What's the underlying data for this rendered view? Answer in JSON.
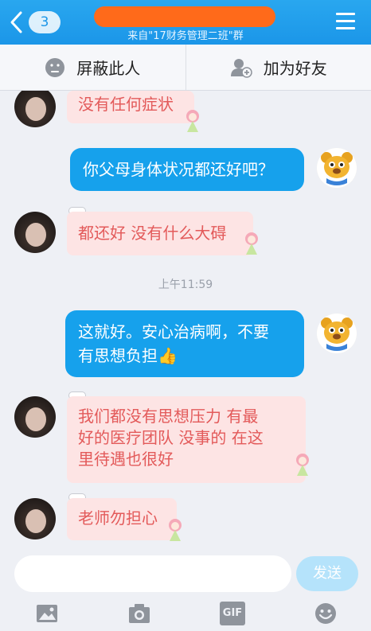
{
  "header": {
    "back_count": "3",
    "subtitle": "来自\"17财务管理二班\"群"
  },
  "actions": {
    "block": "屏蔽此人",
    "add_friend": "加为好友"
  },
  "messages": [
    {
      "side": "left",
      "text": "没有任何症状"
    },
    {
      "side": "right",
      "text": "你父母身体状况都还好吧？"
    },
    {
      "side": "left",
      "text": "都还好 没有什么大碍"
    },
    {
      "side": "right",
      "line1": "这就好。安心治病啊，不要",
      "line2": "有思想负担"
    },
    {
      "side": "left",
      "line1": "我们都没有思想压力 有最",
      "line2": "好的医疗团队 没事的 在这",
      "line3": "里待遇也很好"
    },
    {
      "side": "left",
      "text": "老师勿担心"
    }
  ],
  "timestamp": "上午11:59",
  "emoji": "👍",
  "input": {
    "value": "",
    "send_label": "发送"
  },
  "toolbar": {
    "gif_label": "GIF"
  },
  "colors": {
    "header": "#1b96e8",
    "title_redaction": "#ff6a1a",
    "left_bubble": "#fde4e4",
    "left_text": "#e35a5a",
    "right_bubble": "#16a1ec"
  }
}
